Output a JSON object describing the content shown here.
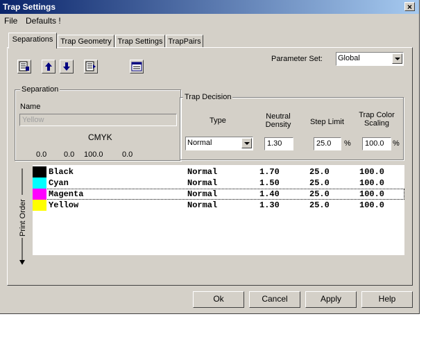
{
  "window": {
    "title": "Trap Settings",
    "close": "×"
  },
  "menu": [
    {
      "label": "File"
    },
    {
      "label": "Defaults !"
    }
  ],
  "tabs": [
    {
      "label": "Separations"
    },
    {
      "label": "Trap Geometry"
    },
    {
      "label": "Trap Settings"
    },
    {
      "label": "TrapPairs"
    }
  ],
  "parameter_set": {
    "label": "Parameter Set:",
    "value": "Global"
  },
  "separation": {
    "group_title": "Separation",
    "name_label": "Name",
    "name_value": "Yellow",
    "cmyk_label": "CMYK",
    "cmyk": [
      "0.0",
      "0.0",
      "100.0",
      "0.0"
    ]
  },
  "trap_decision": {
    "group_title": "Trap Decision",
    "type_label": "Type",
    "neutral_density_label": "Neutral Density",
    "step_limit_label": "Step Limit",
    "trap_color_scaling_label": "Trap Color Scaling",
    "type_value": "Normal",
    "neutral_density_value": "1.30",
    "step_limit_value": "25.0",
    "step_limit_unit": "%",
    "scaling_value": "100.0",
    "scaling_unit": "%"
  },
  "print_order_label": "Print Order",
  "separations": [
    {
      "color": "#000000",
      "name": "Black",
      "type": "Normal",
      "density": "1.70",
      "step": "25.0",
      "scale": "100.0"
    },
    {
      "color": "#00ffff",
      "name": "Cyan",
      "type": "Normal",
      "density": "1.50",
      "step": "25.0",
      "scale": "100.0"
    },
    {
      "color": "#ff00ff",
      "name": "Magenta",
      "type": "Normal",
      "density": "1.40",
      "step": "25.0",
      "scale": "100.0"
    },
    {
      "color": "#ffff00",
      "name": "Yellow",
      "type": "Normal",
      "density": "1.30",
      "step": "25.0",
      "scale": "100.0"
    }
  ],
  "buttons": {
    "ok": "Ok",
    "cancel": "Cancel",
    "apply": "Apply",
    "help": "Help"
  }
}
